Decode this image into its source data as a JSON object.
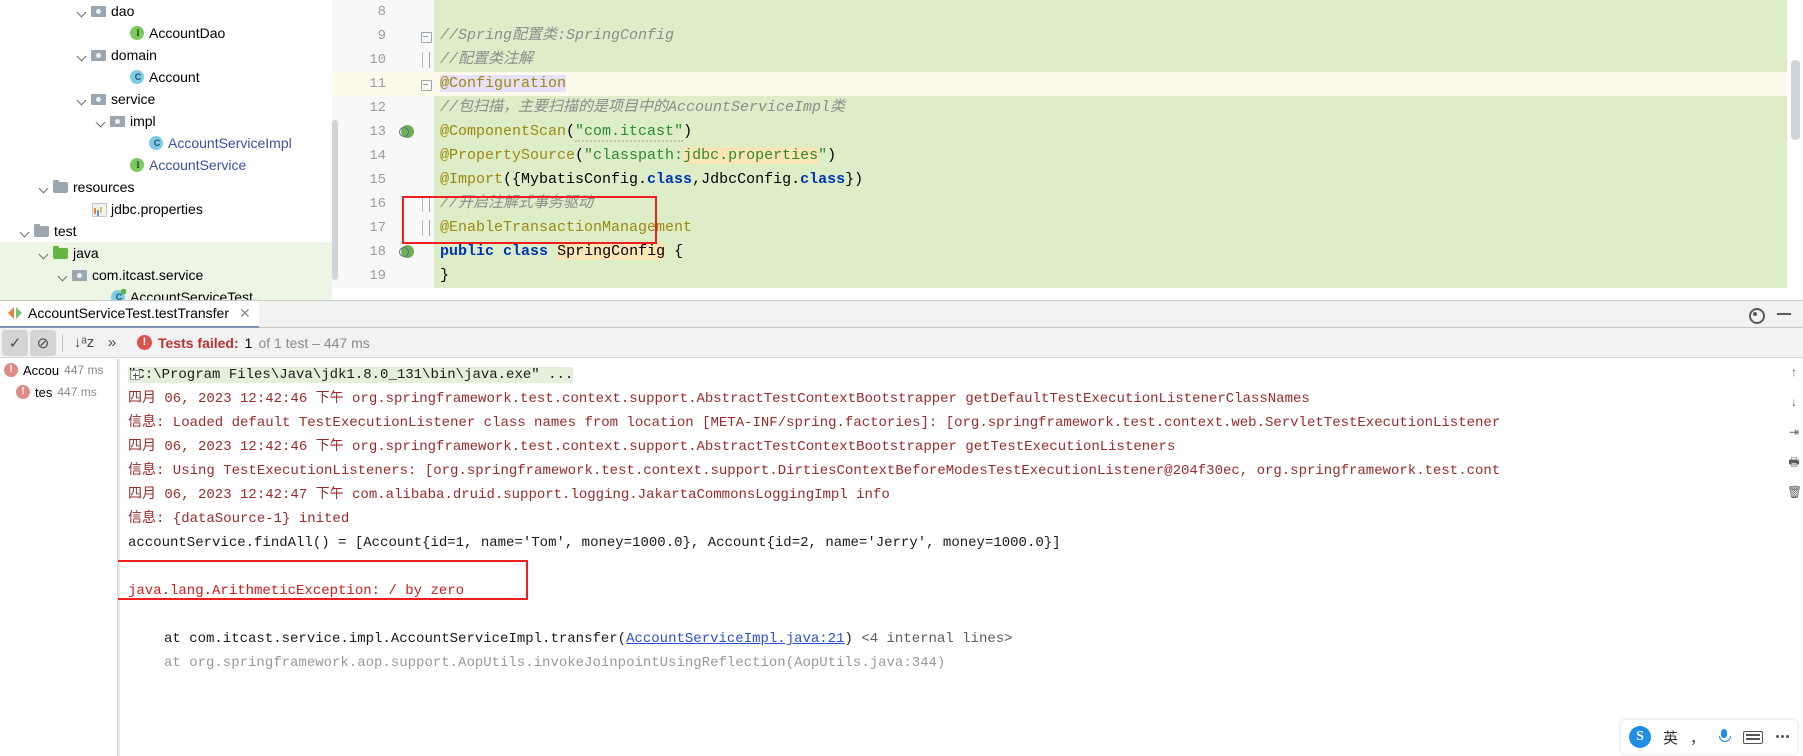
{
  "project_tree": [
    {
      "indent": 4,
      "arrow": "open",
      "icon": "folder-pkg",
      "label": "dao",
      "style": "plain",
      "selected": false
    },
    {
      "indent": 6,
      "arrow": "none",
      "icon": "iface",
      "label": "AccountDao",
      "style": "plain",
      "selected": false
    },
    {
      "indent": 4,
      "arrow": "open",
      "icon": "folder-pkg",
      "label": "domain",
      "style": "plain",
      "selected": false
    },
    {
      "indent": 6,
      "arrow": "none",
      "icon": "cls",
      "label": "Account",
      "style": "plain",
      "selected": false
    },
    {
      "indent": 4,
      "arrow": "open",
      "icon": "folder-pkg",
      "label": "service",
      "style": "plain",
      "selected": false
    },
    {
      "indent": 5,
      "arrow": "open",
      "icon": "folder-pkg",
      "label": "impl",
      "style": "plain",
      "selected": false
    },
    {
      "indent": 7,
      "arrow": "none",
      "icon": "cls",
      "label": "AccountServiceImpl",
      "style": "blue",
      "selected": false
    },
    {
      "indent": 6,
      "arrow": "none",
      "icon": "iface",
      "label": "AccountService",
      "style": "blue",
      "selected": false
    },
    {
      "indent": 2,
      "arrow": "open",
      "icon": "folder",
      "label": "resources",
      "style": "plain",
      "selected": false
    },
    {
      "indent": 4,
      "arrow": "none",
      "icon": "props",
      "label": "jdbc.properties",
      "style": "plain",
      "selected": false
    },
    {
      "indent": 1,
      "arrow": "open",
      "icon": "folder",
      "label": "test",
      "style": "plain",
      "selected": false
    },
    {
      "indent": 2,
      "arrow": "open",
      "icon": "folder-src",
      "label": "java",
      "style": "plain",
      "selected": true
    },
    {
      "indent": 3,
      "arrow": "open",
      "icon": "folder-pkg",
      "label": "com.itcast.service",
      "style": "plain",
      "selected": true
    },
    {
      "indent": 5,
      "arrow": "none",
      "icon": "testcls",
      "label": "AccountServiceTest",
      "style": "plain",
      "selected": true
    }
  ],
  "editor": {
    "lines": [
      {
        "num": "8",
        "fold": "none",
        "gi": "",
        "current": false,
        "html": ""
      },
      {
        "num": "9",
        "fold": "minus",
        "gi": "",
        "current": false,
        "html": "<span class=\"cmt\">//Spring配置类:SpringConfig</span>"
      },
      {
        "num": "10",
        "fold": "bracket",
        "gi": "",
        "current": false,
        "html": "<span class=\"cmt\">//配置类注解</span>"
      },
      {
        "num": "11",
        "fold": "minus",
        "gi": "",
        "current": true,
        "html": "<span class=\"ann hl-inline\">@Configuration</span>"
      },
      {
        "num": "12",
        "fold": "none",
        "gi": "",
        "current": false,
        "html": "<span class=\"cmt\">//包扫描，主要扫描的是项目中的AccountServiceImpl类</span>"
      },
      {
        "num": "13",
        "fold": "none",
        "gi": "bean",
        "current": false,
        "html": "<span class=\"ann\">@ComponentScan</span>(<span class=\"str squig\">\"com.itcast\"</span>)"
      },
      {
        "num": "14",
        "fold": "none",
        "gi": "",
        "current": false,
        "html": "<span class=\"ann\">@PropertySource</span>(<span class=\"str\">\"classpath:</span><span class=\"str hl-prop\">jdbc.properties</span><span class=\"str\">\"</span>)"
      },
      {
        "num": "15",
        "fold": "none",
        "gi": "",
        "current": false,
        "html": "<span class=\"ann\">@Import</span>({MybatisConfig.<span class=\"kw\">class</span>,JdbcConfig.<span class=\"kw\">class</span>})"
      },
      {
        "num": "16",
        "fold": "bracket",
        "gi": "",
        "current": false,
        "html": "<span class=\"cmt\">//开启注解式事务驱动</span>"
      },
      {
        "num": "17",
        "fold": "bracket",
        "gi": "",
        "current": false,
        "html": "<span class=\"ann\">@EnableTransactionManagement</span>"
      },
      {
        "num": "18",
        "fold": "none",
        "gi": "bean",
        "current": false,
        "html": "<span class=\"kw\">public</span> <span class=\"kw\">class</span> <span class=\"hl-prop\">SpringConfig</span> {"
      },
      {
        "num": "19",
        "fold": "none",
        "gi": "",
        "current": false,
        "html": "}"
      }
    ],
    "highlight_box_label": "enable-transaction-management-highlight"
  },
  "tab_bar": {
    "tab_label": "AccountServiceTest.testTransfer",
    "close_glyph": "✕",
    "settings_icon": "gear-icon",
    "minimize_icon": "minimize-icon"
  },
  "test_toolbar": {
    "buttons": [
      {
        "name": "show-passed-button",
        "glyph": "✓",
        "pressed": true
      },
      {
        "name": "show-ignored-button",
        "glyph": "⊘",
        "pressed": true
      },
      {
        "name": "sort-alphabetically-button",
        "glyph": "↓ᵃz",
        "pressed": false
      },
      {
        "name": "expand-all-button",
        "glyph": "»",
        "pressed": false
      }
    ],
    "status_badge": "!",
    "status_failed": "Tests failed:",
    "status_count": "1",
    "status_detail": "of 1 test – 447 ms"
  },
  "test_tree": [
    {
      "badge": "!",
      "name": "Accou",
      "ms": "447 ms",
      "indent": 4
    },
    {
      "badge": "!",
      "name": "tes",
      "ms": "447 ms",
      "indent": 16
    }
  ],
  "console": {
    "lines": [
      {
        "type": "cmd",
        "text": "\"C:\\Program Files\\Java\\jdk1.8.0_131\\bin\\java.exe\" ..."
      },
      {
        "type": "log",
        "text": "四月 06, 2023 12:42:46 下午 org.springframework.test.context.support.AbstractTestContextBootstrapper getDefaultTestExecutionListenerClassNames"
      },
      {
        "type": "log",
        "text": "信息: Loaded default TestExecutionListener class names from location [META-INF/spring.factories]: [org.springframework.test.context.web.ServletTestExecutionListener"
      },
      {
        "type": "log",
        "text": "四月 06, 2023 12:42:46 下午 org.springframework.test.context.support.AbstractTestContextBootstrapper getTestExecutionListeners"
      },
      {
        "type": "log",
        "text": "信息: Using TestExecutionListeners: [org.springframework.test.context.support.DirtiesContextBeforeModesTestExecutionListener@204f30ec, org.springframework.test.cont"
      },
      {
        "type": "log",
        "text": "四月 06, 2023 12:42:47 下午 com.alibaba.druid.support.logging.JakartaCommonsLoggingImpl info"
      },
      {
        "type": "log",
        "text": "信息: {dataSource-1} inited"
      },
      {
        "type": "plain",
        "text": "accountService.findAll() = [Account{id=1, name='Tom', money=1000.0}, Account{id=2, name='Jerry', money=1000.0}]"
      },
      {
        "type": "blank",
        "text": ""
      },
      {
        "type": "exc",
        "text": "java.lang.ArithmeticException: / by zero"
      },
      {
        "type": "blank",
        "text": ""
      }
    ],
    "trace_prefix": "at com.itcast.service.impl.AccountServiceImpl.transfer(",
    "trace_link": "AccountServiceImpl.java:21",
    "trace_suffix": ")",
    "trace_internal": "<4 internal lines>",
    "truncated_line": "at org.springframework.aop.support.AopUtils.invokeJoinpointUsingReflection(AopUtils.java:344)",
    "exception_box_label": "arithmetic-exception-highlight"
  },
  "right_rail": [
    {
      "name": "scroll-up-icon",
      "glyph": "↑"
    },
    {
      "name": "scroll-down-icon",
      "glyph": "↓"
    },
    {
      "name": "soft-wrap-icon",
      "glyph": "⇥"
    },
    {
      "name": "print-icon",
      "glyph": "🖶"
    },
    {
      "name": "trash-icon",
      "glyph": "🗑"
    }
  ],
  "ime_toolbar": {
    "logo": "sogou-logo-icon",
    "lang_label": "英",
    "comma_label": "，",
    "mic_icon": "microphone-icon",
    "keyboard_icon": "keyboard-icon",
    "menu_icon": "more-options-icon"
  },
  "colors": {
    "code_bg": "#dcedc8",
    "current_line": "#fdfcec",
    "selection_green": "#edf6e4",
    "error_red": "#d01b1b",
    "box_red": "#f01f1f",
    "log_red": "#9c2a2a",
    "link_blue": "#2a4fd9"
  }
}
